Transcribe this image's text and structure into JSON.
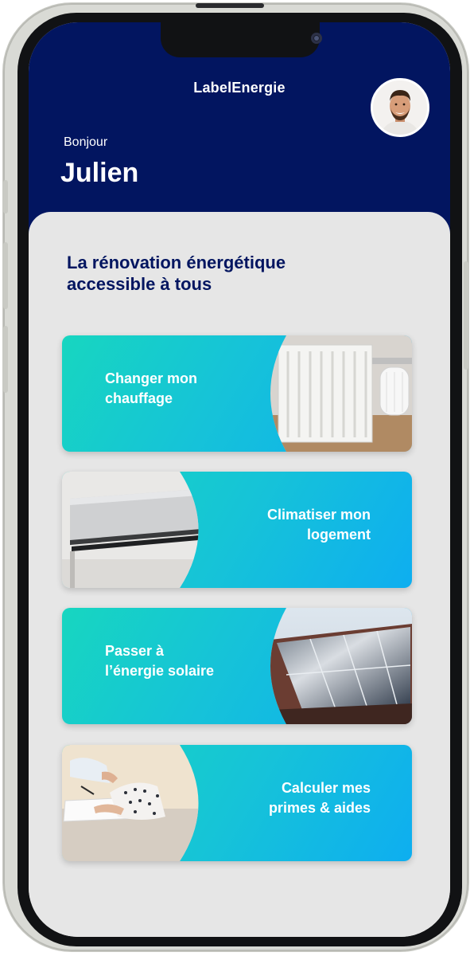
{
  "app": {
    "brand": "LabelEnergie",
    "greeting": "Bonjour",
    "user_name": "Julien"
  },
  "main": {
    "headline_line1": "La rénovation énergétique",
    "headline_line2": "accessible à tous"
  },
  "cards": [
    {
      "line1": "Changer mon",
      "line2": "chauffage",
      "image": "radiator-thermostat-photo"
    },
    {
      "line1": "Climatiser mon",
      "line2": "logement",
      "image": "air-conditioner-photo"
    },
    {
      "line1": "Passer à",
      "line2": "l’énergie solaire",
      "image": "solar-panels-photo"
    },
    {
      "line1": "Calculer mes",
      "line2": "primes & aides",
      "image": "people-signing-documents-photo"
    }
  ],
  "colors": {
    "header_navy": "#021560",
    "headline_navy": "#021560",
    "card_gradient_teal": "#17d6c0",
    "card_gradient_blue": "#0eaef0",
    "background_gray": "#e6e6e6"
  }
}
